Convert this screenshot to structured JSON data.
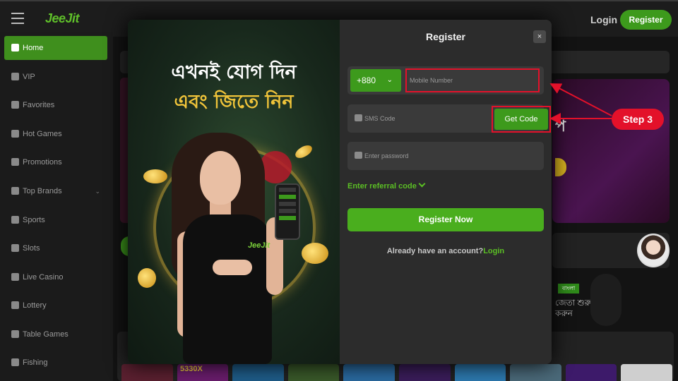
{
  "header": {
    "logo_text": "JeeJit",
    "login_label": "Login",
    "register_label": "Register",
    "icons": [
      "menu-icon"
    ]
  },
  "sidebar": {
    "items": [
      {
        "label": "Home",
        "icon": "home-icon",
        "active": true
      },
      {
        "label": "VIP",
        "icon": "vip-icon"
      },
      {
        "label": "Favorites",
        "icon": "star-icon"
      },
      {
        "label": "Hot Games",
        "icon": "fire-icon"
      },
      {
        "label": "Promotions",
        "icon": "gift-icon"
      },
      {
        "label": "Top Brands",
        "icon": "brand-icon",
        "expandable": true
      },
      {
        "label": "Sports",
        "icon": "ball-icon"
      },
      {
        "label": "Slots",
        "icon": "slots-icon"
      },
      {
        "label": "Live Casino",
        "icon": "spade-icon"
      },
      {
        "label": "Lottery",
        "icon": "lottery-icon"
      },
      {
        "label": "Table Games",
        "icon": "cards-icon"
      },
      {
        "label": "Fishing",
        "icon": "fish-icon"
      }
    ]
  },
  "background": {
    "game_badge": "5330X",
    "promo_text_line1": "জেতা শুরু",
    "promo_text_line2": "করুন"
  },
  "promo": {
    "line1": "এখনই যোগ দিন",
    "line2": "এবং জিতে নিন",
    "dress_logo": "JeeJit"
  },
  "register": {
    "title": "Register",
    "close": "×",
    "country_code": "+880",
    "mobile_placeholder": "Mobile Number",
    "sms_placeholder": "SMS Code",
    "get_code_label": "Get Code",
    "password_placeholder": "Enter password",
    "referral_label": "Enter referral code",
    "register_now_label": "Register Now",
    "have_account_text": "Already have an account?",
    "login_link": "Login"
  },
  "annotation": {
    "step_label": "Step 3",
    "color": "#e3112a"
  },
  "colors": {
    "accent_green": "#3d9a1c",
    "highlight_red": "#e3112a",
    "panel_bg": "#2c2c2c"
  }
}
